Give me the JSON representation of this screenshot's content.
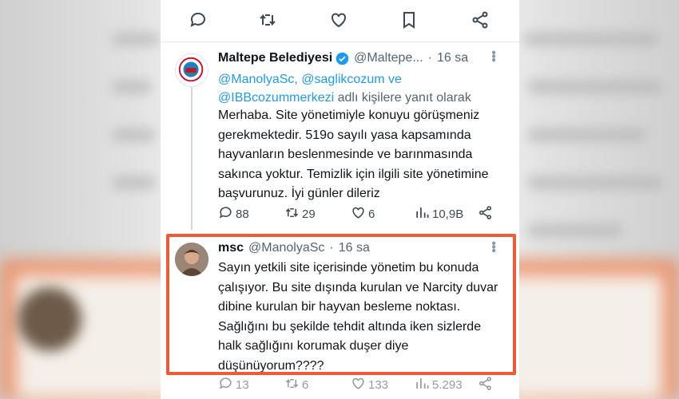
{
  "top_actions": {
    "icons": [
      "reply-icon",
      "retweet-icon",
      "like-icon",
      "bookmark-icon",
      "share-icon"
    ]
  },
  "tweet1": {
    "author_name": "Maltepe Belediyesi",
    "author_handle": "@Maltepe...",
    "separator": "·",
    "time": "16 sa",
    "reply_prefix_mentions": "@ManolyaSc, @saglikcozum ve @IBBcozummerkezi",
    "reply_suffix": "adlı kişilere yanıt olarak",
    "text": "Merhaba. Site yönetimiyle konuyu görüşmeniz gerekmektedir. 519o sayılı yasa kapsamında hayvanların beslenmesinde ve barınmasında sakınca yoktur. Temizlik için ilgili site yönetimine başvurunuz. İyi günler dileriz",
    "metrics": {
      "replies": "88",
      "retweets": "29",
      "likes": "6",
      "views": "10,9B"
    }
  },
  "tweet2": {
    "author_name": "msc",
    "author_handle": "@ManolyaSc",
    "separator": "·",
    "time": "16 sa",
    "text": "Sayın yetkili site içerisinde yönetim bu konuda çalışıyor. Bu site dışında kurulan ve Narcity duvar dibine kurulan bir hayvan besleme noktası. Sağlığını bu şekilde tehdit altında iken sizlerde halk sağlığını korumak duşer  diye düşünüyorum????",
    "metrics": {
      "replies": "13",
      "retweets": "6",
      "likes": "133",
      "views": "5.293"
    }
  },
  "colors": {
    "highlight": "#f05a36",
    "verified": "#1d9bf0",
    "mention": "#1d9bf0"
  }
}
